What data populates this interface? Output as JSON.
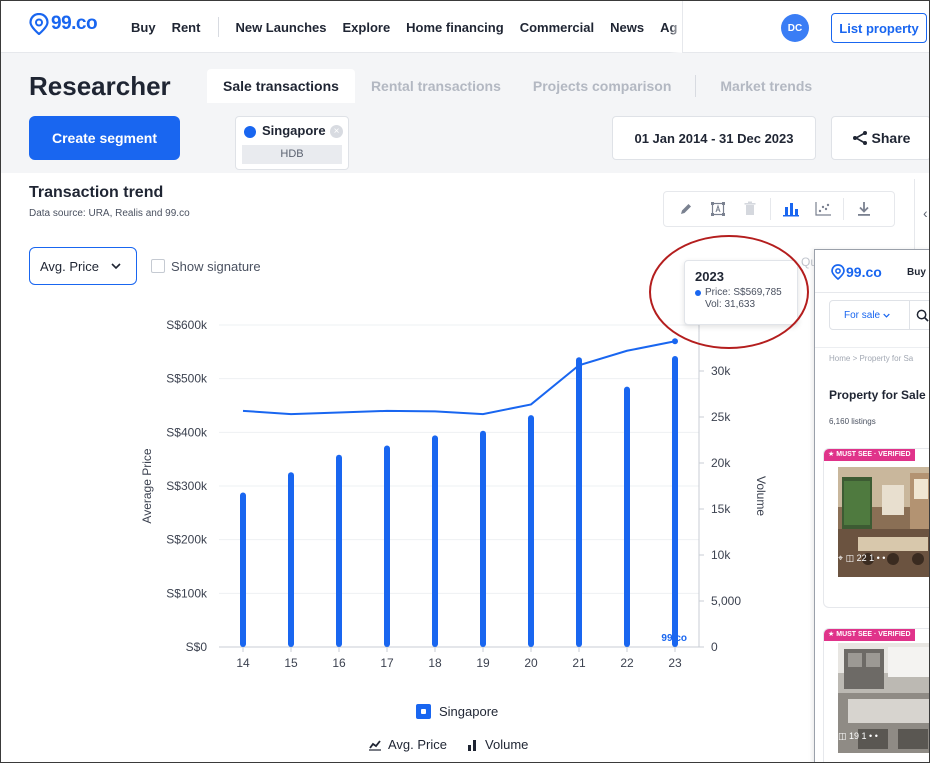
{
  "nav": {
    "logo": "99.co",
    "links": [
      "Buy",
      "Rent",
      "New Launches",
      "Explore",
      "Home financing",
      "Commercial",
      "News",
      "Ag"
    ],
    "avatar": "DC",
    "list_property": "List property"
  },
  "header": {
    "title": "Researcher",
    "tabs": [
      {
        "label": "Sale transactions",
        "active": true
      },
      {
        "label": "Rental transactions",
        "active": false
      },
      {
        "label": "Projects comparison",
        "active": false
      },
      {
        "label": "Market trends",
        "active": false
      }
    ]
  },
  "controls": {
    "create_segment": "Create segment",
    "segment": {
      "name": "Singapore",
      "type": "HDB"
    },
    "date_range": "01 Jan 2014 - 31 Dec 2023",
    "share": "Share"
  },
  "trend": {
    "title": "Transaction trend",
    "source": "Data source: URA, Realis and 99.co",
    "metric_select": "Avg. Price",
    "show_signature": "Show signature",
    "quarter_fragment": "Qua"
  },
  "tooltip": {
    "year": "2023",
    "price": "Price: S$569,785",
    "vol": "Vol: 31,633"
  },
  "legend": {
    "series": "Singapore",
    "avg_price": "Avg. Price",
    "volume": "Volume"
  },
  "chart_data": {
    "type": "bar",
    "categories": [
      "14",
      "15",
      "16",
      "17",
      "18",
      "19",
      "20",
      "21",
      "22",
      "23"
    ],
    "xlabel": "",
    "ylabel": "Average Price",
    "y2label": "Volume",
    "ylim": [
      0,
      600000
    ],
    "y2lim": [
      0,
      35000
    ],
    "yticks": [
      "S$0",
      "S$100k",
      "S$200k",
      "S$300k",
      "S$400k",
      "S$500k",
      "S$600k"
    ],
    "y2ticks": [
      "0",
      "5,000",
      "10k",
      "15k",
      "20k",
      "25k",
      "30k"
    ],
    "watermark": "99.co",
    "series": [
      {
        "name": "Volume",
        "type": "bar",
        "axis": "right",
        "values": [
          16800,
          19000,
          20900,
          21900,
          23000,
          23500,
          25200,
          31500,
          28300,
          31633
        ]
      },
      {
        "name": "Avg. Price",
        "type": "line",
        "axis": "left",
        "values": [
          440000,
          434000,
          437000,
          440000,
          439000,
          434000,
          452000,
          525000,
          552000,
          569785
        ]
      }
    ],
    "grid": true,
    "color": "#1966f0"
  },
  "panel": {
    "logo": "99.co",
    "buy": "Buy",
    "for_sale": "For sale",
    "breadcrumb": "Home > Property for Sa",
    "title": "Property for Sale",
    "count": "6,160 listings",
    "badge1": "MUST SEE · VERIFIED",
    "badge2": "MUST SEE · VERIFIED",
    "card1_icons": "22 1",
    "card2_icons": "19 1"
  }
}
